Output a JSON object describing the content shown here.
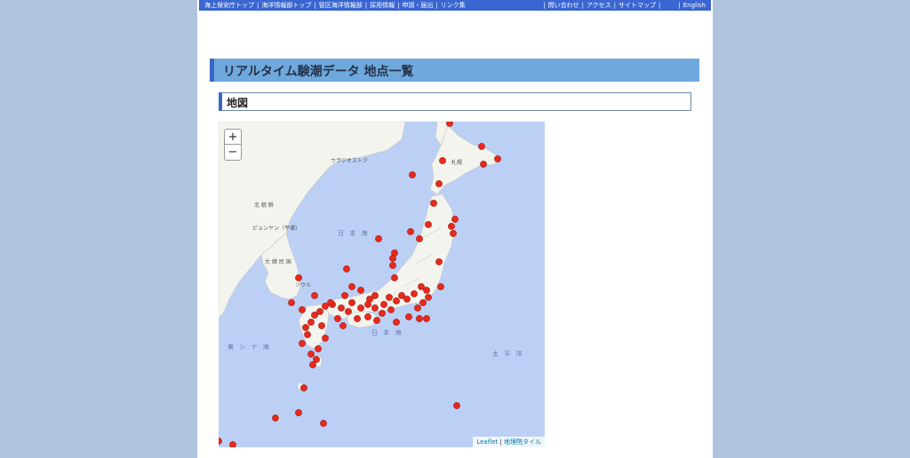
{
  "nav": {
    "left": [
      "海上保安庁トップ",
      "海洋情報部トップ",
      "管区海洋情報部",
      "採用情報",
      "申請・届出",
      "リンク集"
    ],
    "right": [
      "問い合わせ",
      "アクセス",
      "サイトマップ"
    ],
    "english": "English"
  },
  "page": {
    "title": "リアルタイム験潮データ 地点一覧",
    "section": "地図"
  },
  "map": {
    "zoom_in": "+",
    "zoom_out": "−",
    "attribution_leaflet": "Leaflet",
    "attribution_sep": " | ",
    "attribution_tiles": "地理院タイル",
    "labels": {
      "vladivostok": "ウラジオストク",
      "sea_of_japan": "日 本 海",
      "pacific": "太 平 洋",
      "east_china_sea": "東 シ ナ 海",
      "north_korea": "北 朝 鮮",
      "south_korea": "大 韓 民 国",
      "pyongyang": "ピョンヤン（平壌）",
      "seoul": "ソウル",
      "sea_of_japan_south": "日 本 海",
      "sapporo": "札幌"
    },
    "marker_color": "#e8291c",
    "land_color": "#f4f4ef",
    "sea_color": "#bcd0f6"
  }
}
